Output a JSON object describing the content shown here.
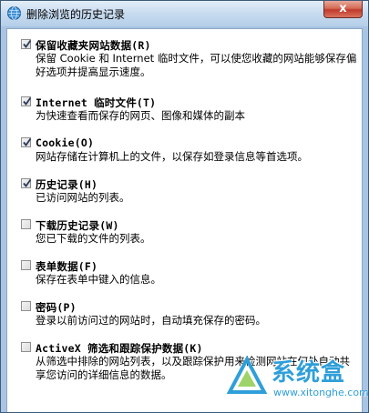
{
  "window": {
    "title": "删除浏览的历史记录",
    "close_label": "x"
  },
  "options": [
    {
      "checked": true,
      "label": "保留收藏夹网站数据(R)",
      "description": "保留 Cookie 和 Internet 临时文件，可以使您收藏的网站能够保存偏好选项并提高显示速度。"
    },
    {
      "checked": true,
      "label": "Internet 临时文件(T)",
      "description": "为快速查看而保存的网页、图像和媒体的副本"
    },
    {
      "checked": true,
      "label": "Cookie(O)",
      "description": "网站存储在计算机上的文件，以保存如登录信息等首选项。"
    },
    {
      "checked": true,
      "label": "历史记录(H)",
      "description": "已访问网站的列表。"
    },
    {
      "checked": false,
      "label": "下载历史记录(W)",
      "description": "您已下载的文件的列表。"
    },
    {
      "checked": false,
      "label": "表单数据(F)",
      "description": "保存在表单中键入的信息。"
    },
    {
      "checked": false,
      "label": "密码(P)",
      "description": "登录以前访问过的网站时，自动填充保存的密码。"
    },
    {
      "checked": false,
      "label": "ActiveX 筛选和跟踪保护数据(K)",
      "description": "从筛选中排除的网站列表，以及跟踪保护用来检测网站在何处自动共享您访问的详细信息的数据。"
    }
  ],
  "watermark": {
    "name": "系统盒",
    "url": "www.xitonghe.com"
  },
  "colors": {
    "title_bar": "#c7dbef",
    "close_button": "#c0392b",
    "watermark": "#2f9fd9"
  }
}
